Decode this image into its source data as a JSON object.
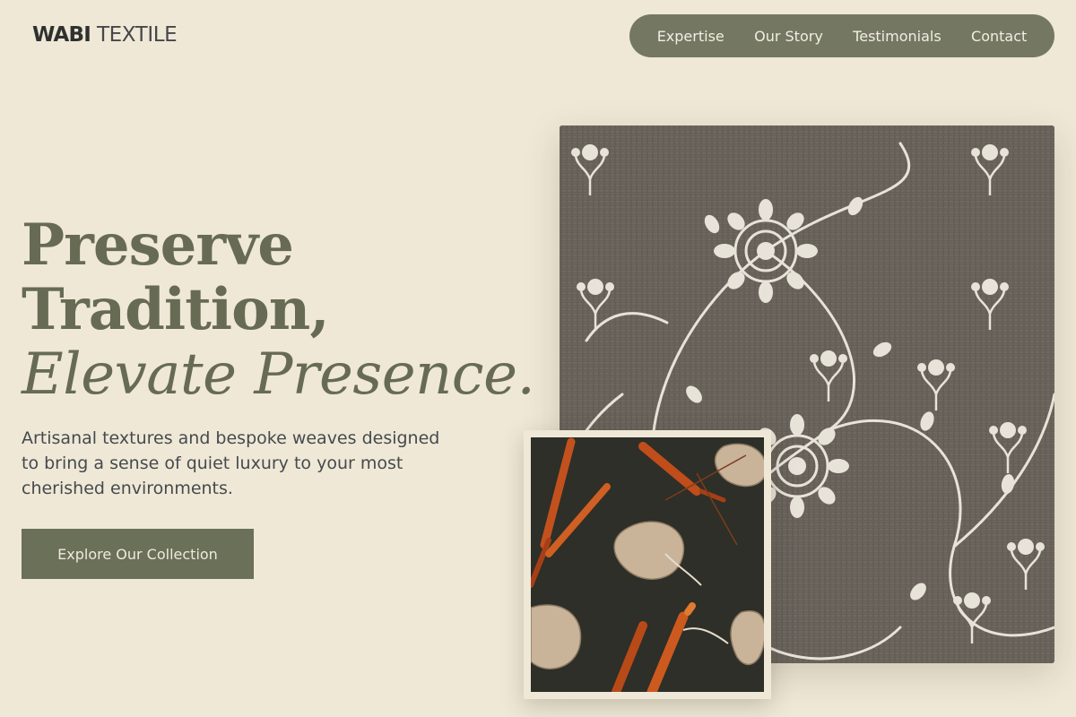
{
  "brand": {
    "logo_bold": "WABI",
    "logo_light": " TEXTILE"
  },
  "nav": {
    "items": [
      {
        "label": "Expertise"
      },
      {
        "label": "Our Story"
      },
      {
        "label": "Testimonials"
      },
      {
        "label": "Contact"
      }
    ]
  },
  "hero": {
    "title_line1": "Preserve",
    "title_line2": "Tradition,",
    "title_line3": "Elevate Presence.",
    "subtitle": "Artisanal textures and bespoke weaves designed to bring a sense of quiet luxury to your most cherished environments.",
    "cta_label": "Explore Our Collection"
  },
  "images": {
    "large_fabric": "grey-linen-fabric-with-white-floral-embroidery",
    "small_fabric": "dark-fabric-with-orange-stamens-and-beige-leaves"
  },
  "colors": {
    "background": "#efe8d6",
    "accent": "#6b7059",
    "nav_bg": "#747863",
    "title": "#676b53"
  }
}
